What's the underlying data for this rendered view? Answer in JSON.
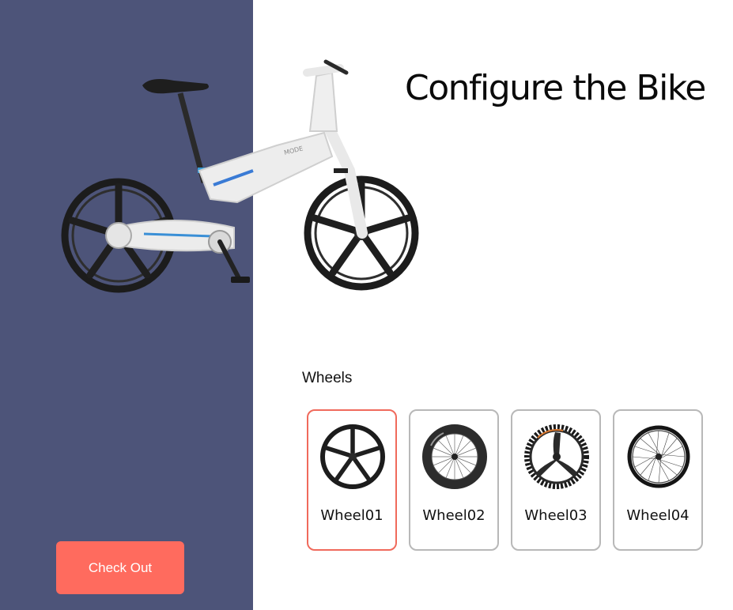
{
  "page": {
    "title": "Configure the Bike"
  },
  "colors": {
    "side_panel": "#4d5479",
    "accent": "#ff6b5e",
    "selected_border": "#f06a5c",
    "card_border": "#b8b8b8"
  },
  "configurator": {
    "section_label": "Wheels",
    "selected_index": 0,
    "options": [
      {
        "label": "Wheel01",
        "icon": "five-spoke-wheel-icon",
        "selected": true
      },
      {
        "label": "Wheel02",
        "icon": "deep-rim-wheel-icon",
        "selected": false
      },
      {
        "label": "Wheel03",
        "icon": "tri-spoke-wheel-icon",
        "selected": false
      },
      {
        "label": "Wheel04",
        "icon": "wire-spoke-wheel-icon",
        "selected": false
      }
    ]
  },
  "preview": {
    "image": "bike-with-five-spoke-wheels",
    "frame_brand": "MODE"
  },
  "checkout": {
    "label": "Check Out"
  }
}
